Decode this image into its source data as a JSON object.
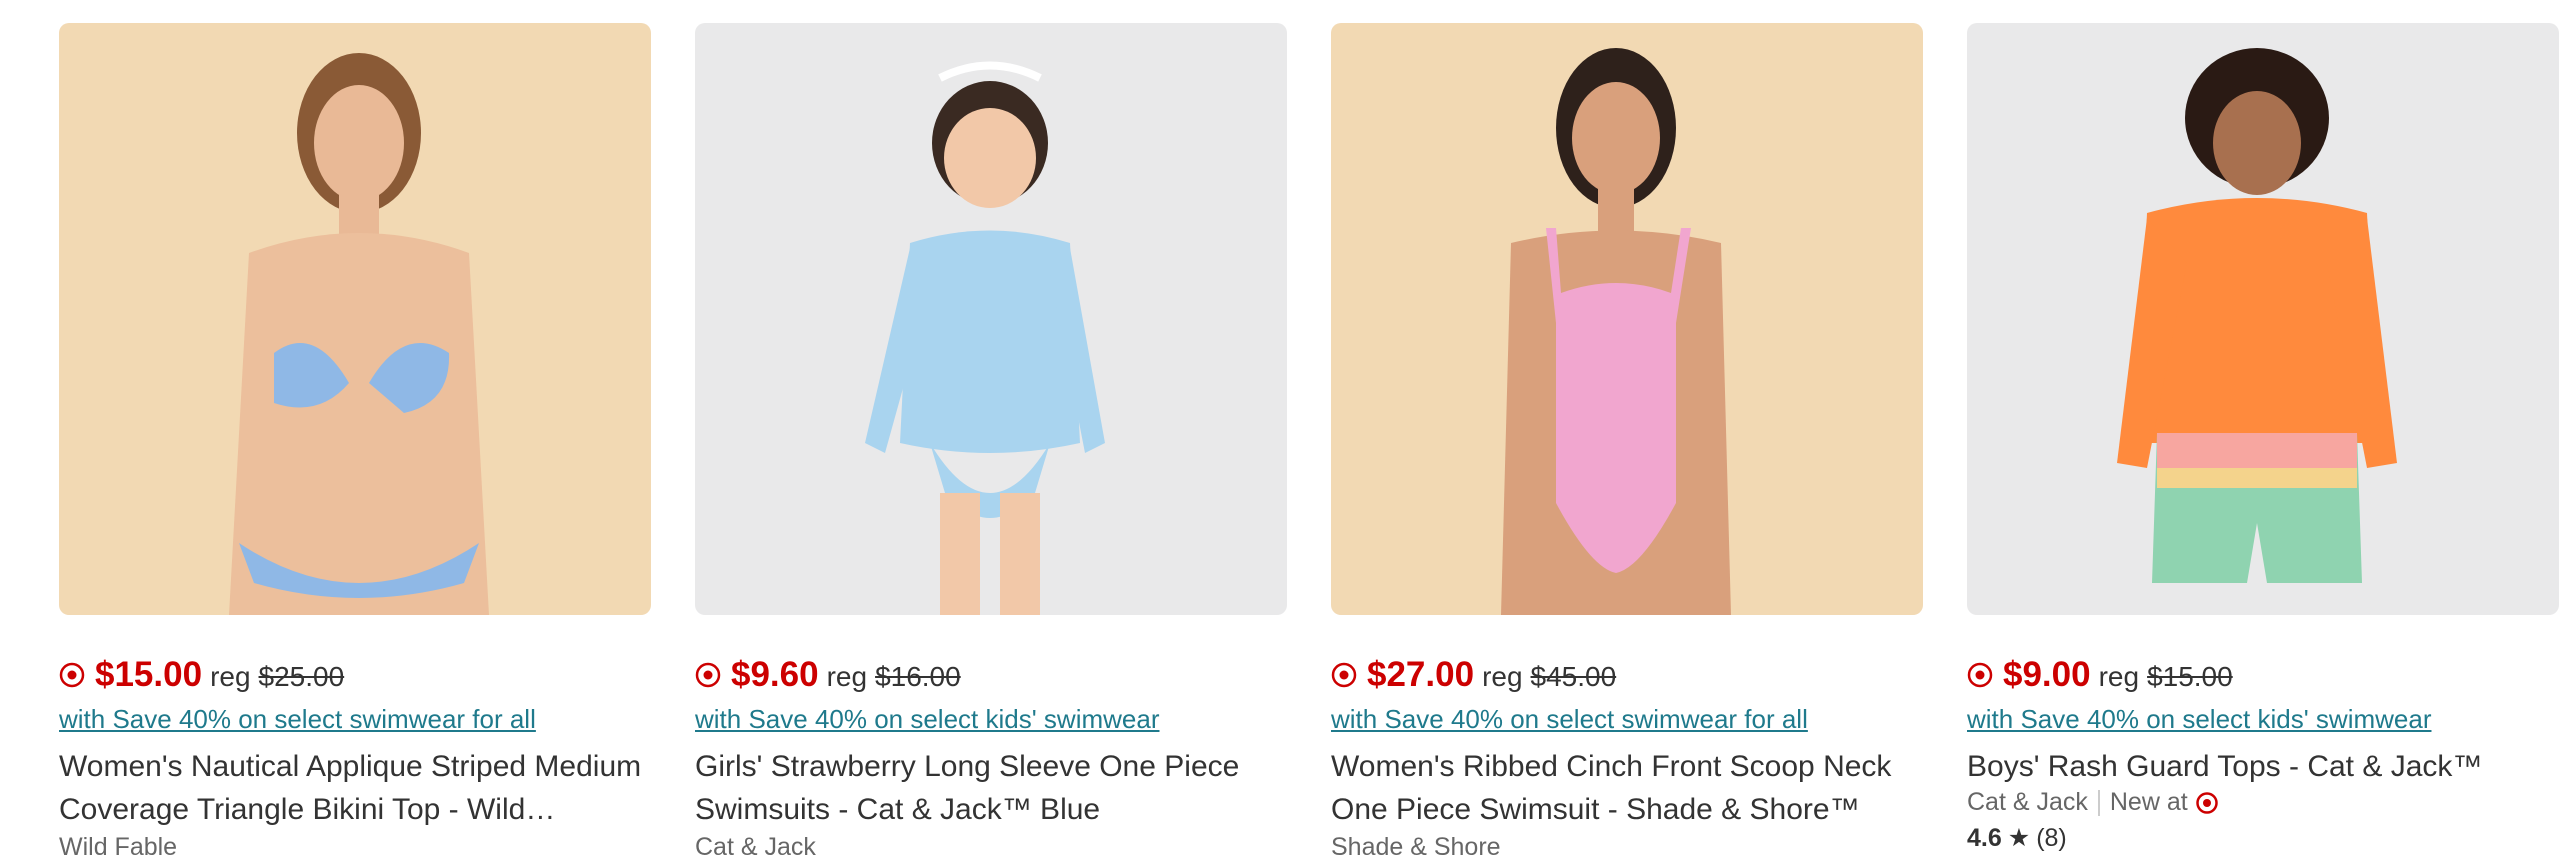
{
  "products": [
    {
      "price": "$15.00",
      "reg_label": "reg",
      "reg_price": "$25.00",
      "promo": "with Save 40% on select swimwear for all",
      "title": "Women's Nautical Applique Striped Medium Coverage Triangle Bikini Top - Wild Fable™...",
      "brand": "Wild Fable"
    },
    {
      "price": "$9.60",
      "reg_label": "reg",
      "reg_price": "$16.00",
      "promo": "with Save 40% on select kids' swimwear",
      "title": "Girls' Strawberry Long Sleeve One Piece Swimsuits - Cat & Jack™ Blue",
      "brand": "Cat & Jack"
    },
    {
      "price": "$27.00",
      "reg_label": "reg",
      "reg_price": "$45.00",
      "promo": "with Save 40% on select swimwear for all",
      "title": "Women's Ribbed Cinch Front Scoop Neck One Piece Swimsuit - Shade & Shore™",
      "brand": "Shade & Shore"
    },
    {
      "price": "$9.00",
      "reg_label": "reg",
      "reg_price": "$15.00",
      "promo": "with Save 40% on select kids' swimwear",
      "title": "Boys' Rash Guard Tops - Cat & Jack™",
      "brand": "Cat & Jack",
      "new_at": "New at",
      "rating": "4.6",
      "review_count": "(8)"
    }
  ],
  "colors": {
    "sale_price": "#cc0000",
    "promo_link": "#1f7a8c",
    "text": "#333333",
    "muted": "#666666"
  },
  "icons": {
    "price_tag": "target-circle-icon",
    "new_at_logo": "target-bullseye-icon",
    "rating_star": "star-icon"
  }
}
